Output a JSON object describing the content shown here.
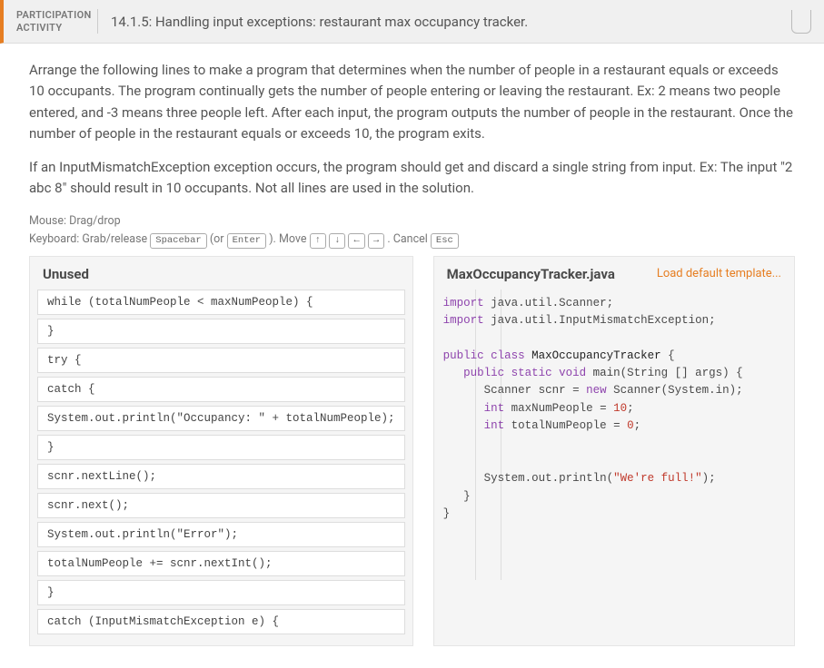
{
  "header": {
    "label_line1": "PARTICIPATION",
    "label_line2": "ACTIVITY",
    "title": "14.1.5: Handling input exceptions: restaurant max occupancy tracker."
  },
  "instructions": {
    "p1": "Arrange the following lines to make a program that determines when the number of people in a restaurant equals or exceeds 10 occupants. The program continually gets the number of people entering or leaving the restaurant. Ex: 2 means two people entered, and -3 means three people left. After each input, the program outputs the number of people in the restaurant. Once the number of people in the restaurant equals or exceeds 10, the program exits.",
    "p2": "If an InputMismatchException exception occurs, the program should get and discard a single string from input. Ex: The input \"2 abc 8\" should result in 10 occupants. Not all lines are used in the solution."
  },
  "hints": {
    "mouse": "Mouse: Drag/drop",
    "kb_label": "Keyboard: Grab/release",
    "kb_spacebar": "Spacebar",
    "kb_or": "(or",
    "kb_enter": "Enter",
    "kb_close": ").",
    "move_label": "Move",
    "move_up": "↑",
    "move_down": "↓",
    "move_left": "←",
    "move_right": "→",
    "move_dot": ".",
    "cancel_label": "Cancel",
    "cancel_key": "Esc"
  },
  "panels": {
    "unused_title": "Unused",
    "code_title": "MaxOccupancyTracker.java",
    "load_link": "Load default template..."
  },
  "tiles": [
    "while (totalNumPeople < maxNumPeople) {",
    "}",
    "try {",
    "catch {",
    "System.out.println(\"Occupancy: \" + totalNumPeople);",
    "}",
    "scnr.nextLine();",
    "scnr.next();",
    "System.out.println(\"Error\");",
    "totalNumPeople += scnr.nextInt();",
    "}",
    "catch (InputMismatchException e) {"
  ],
  "code": {
    "l1_a": "import",
    "l1_b": " java.util.Scanner;",
    "l2_a": "import",
    "l2_b": " java.util.InputMismatchException;",
    "l3_a": "public",
    "l3_b": " class",
    "l3_c": " MaxOccupancyTracker",
    "l3_d": " {",
    "l4_a": "   public",
    "l4_b": " static",
    "l4_c": " void",
    "l4_d": " main",
    "l4_e": "(String [] args) {",
    "l5_a": "      Scanner scnr = ",
    "l5_b": "new",
    "l5_c": " Scanner(System.in);",
    "l6_a": "      int",
    "l6_b": " maxNumPeople = ",
    "l6_c": "10",
    "l6_d": ";",
    "l7_a": "      int",
    "l7_b": " totalNumPeople = ",
    "l7_c": "0",
    "l7_d": ";",
    "gap1": "",
    "gap2": "",
    "l8_a": "      System.out.println(",
    "l8_b": "\"We're full!\"",
    "l8_c": ");",
    "l9": "   }",
    "l10": "}"
  }
}
